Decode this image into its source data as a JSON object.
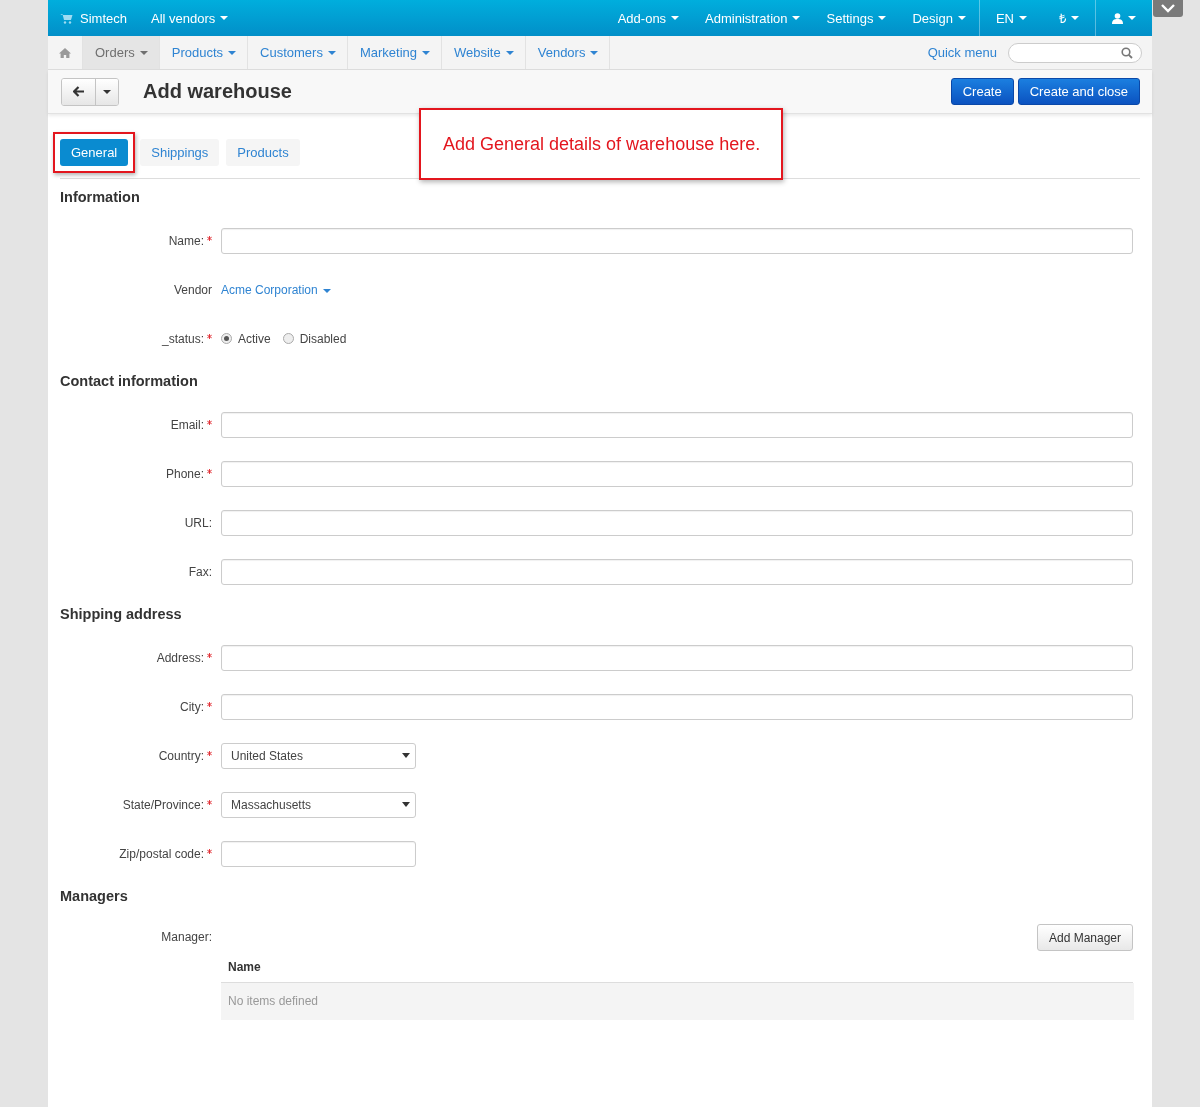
{
  "top_bar": {
    "store": "Simtech",
    "vendor_switch": "All vendors",
    "menus": [
      "Add-ons",
      "Administration",
      "Settings",
      "Design"
    ],
    "language": "EN",
    "currency": "₺"
  },
  "nav": {
    "items": [
      {
        "label": "Orders",
        "selected": true
      },
      {
        "label": "Products",
        "selected": false
      },
      {
        "label": "Customers",
        "selected": false
      },
      {
        "label": "Marketing",
        "selected": false
      },
      {
        "label": "Website",
        "selected": false
      },
      {
        "label": "Vendors",
        "selected": false
      }
    ],
    "quick_menu": "Quick menu"
  },
  "header": {
    "title": "Add warehouse",
    "buttons": [
      "Create",
      "Create and close"
    ]
  },
  "tabs": [
    {
      "label": "General",
      "selected": true,
      "highlighted": true
    },
    {
      "label": "Shippings",
      "selected": false,
      "highlighted": false
    },
    {
      "label": "Products",
      "selected": false,
      "highlighted": false
    }
  ],
  "callout": "Add General details of warehouse here.",
  "sections": [
    {
      "title": "Information",
      "fields": [
        {
          "kind": "text",
          "label": "Name:",
          "required": true
        },
        {
          "kind": "link",
          "label": "Vendor",
          "required": false,
          "value": "Acme Corporation"
        },
        {
          "kind": "radio",
          "label": "_status:",
          "required": true,
          "options": [
            {
              "label": "Active",
              "selected": true
            },
            {
              "label": "Disabled",
              "selected": false
            }
          ]
        }
      ]
    },
    {
      "title": "Contact information",
      "fields": [
        {
          "kind": "text",
          "label": "Email:",
          "required": true
        },
        {
          "kind": "text",
          "label": "Phone:",
          "required": true
        },
        {
          "kind": "text",
          "label": "URL:",
          "required": false
        },
        {
          "kind": "text",
          "label": "Fax:",
          "required": false
        }
      ]
    },
    {
      "title": "Shipping address",
      "fields": [
        {
          "kind": "text",
          "label": "Address:",
          "required": true
        },
        {
          "kind": "text",
          "label": "City:",
          "required": true
        },
        {
          "kind": "select",
          "label": "Country:",
          "required": true,
          "value": "United States"
        },
        {
          "kind": "select",
          "label": "State/Province:",
          "required": true,
          "value": "Massachusetts"
        },
        {
          "kind": "short",
          "label": "Zip/postal code:",
          "required": true
        }
      ]
    }
  ],
  "managers": {
    "title": "Managers",
    "label": "Manager:",
    "button": "Add Manager",
    "column": "Name",
    "empty": "No items defined"
  }
}
